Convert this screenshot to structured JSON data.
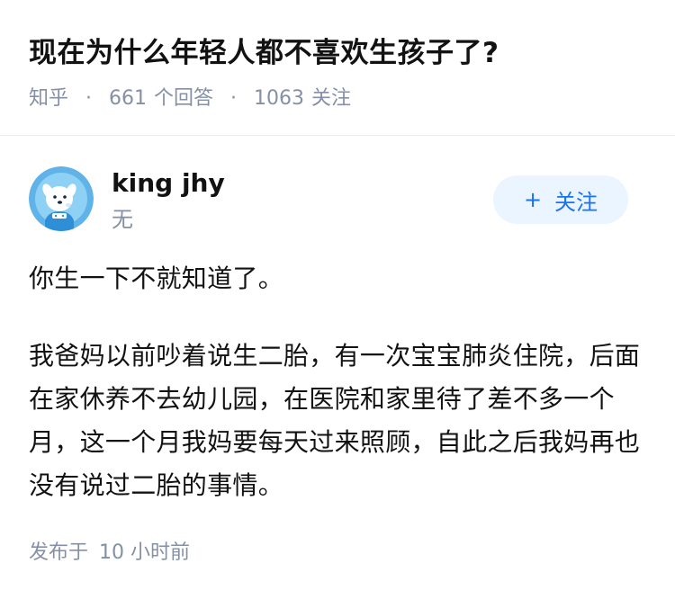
{
  "question": {
    "title": "现在为什么年轻人都不喜欢生孩子了?",
    "source": "知乎",
    "answer_count": "661",
    "answer_label": "个回答",
    "follower_count": "1063",
    "follower_label": "关注",
    "separator": "·"
  },
  "author": {
    "name": "king jhy",
    "bio": "无",
    "avatar_icon": "cartoon-dog-avatar",
    "follow_plus": "+",
    "follow_label": "关注"
  },
  "answer": {
    "paragraphs": [
      "你生一下不就知道了。",
      "我爸妈以前吵着说生二胎，有一次宝宝肺炎住院，后面在家休养不去幼儿园，在医院和家里待了差不多一个月，这一个月我妈要每天过来照顾，自此之后我妈再也没有说过二胎的事情。"
    ],
    "published_label": "发布于",
    "published_time": "10 小时前"
  },
  "colors": {
    "primary_text": "#121212",
    "secondary_text": "#8590a6",
    "accent": "#1772f6",
    "accent_bg": "#ebf5ff",
    "avatar_bg": "#5fb3e8"
  }
}
